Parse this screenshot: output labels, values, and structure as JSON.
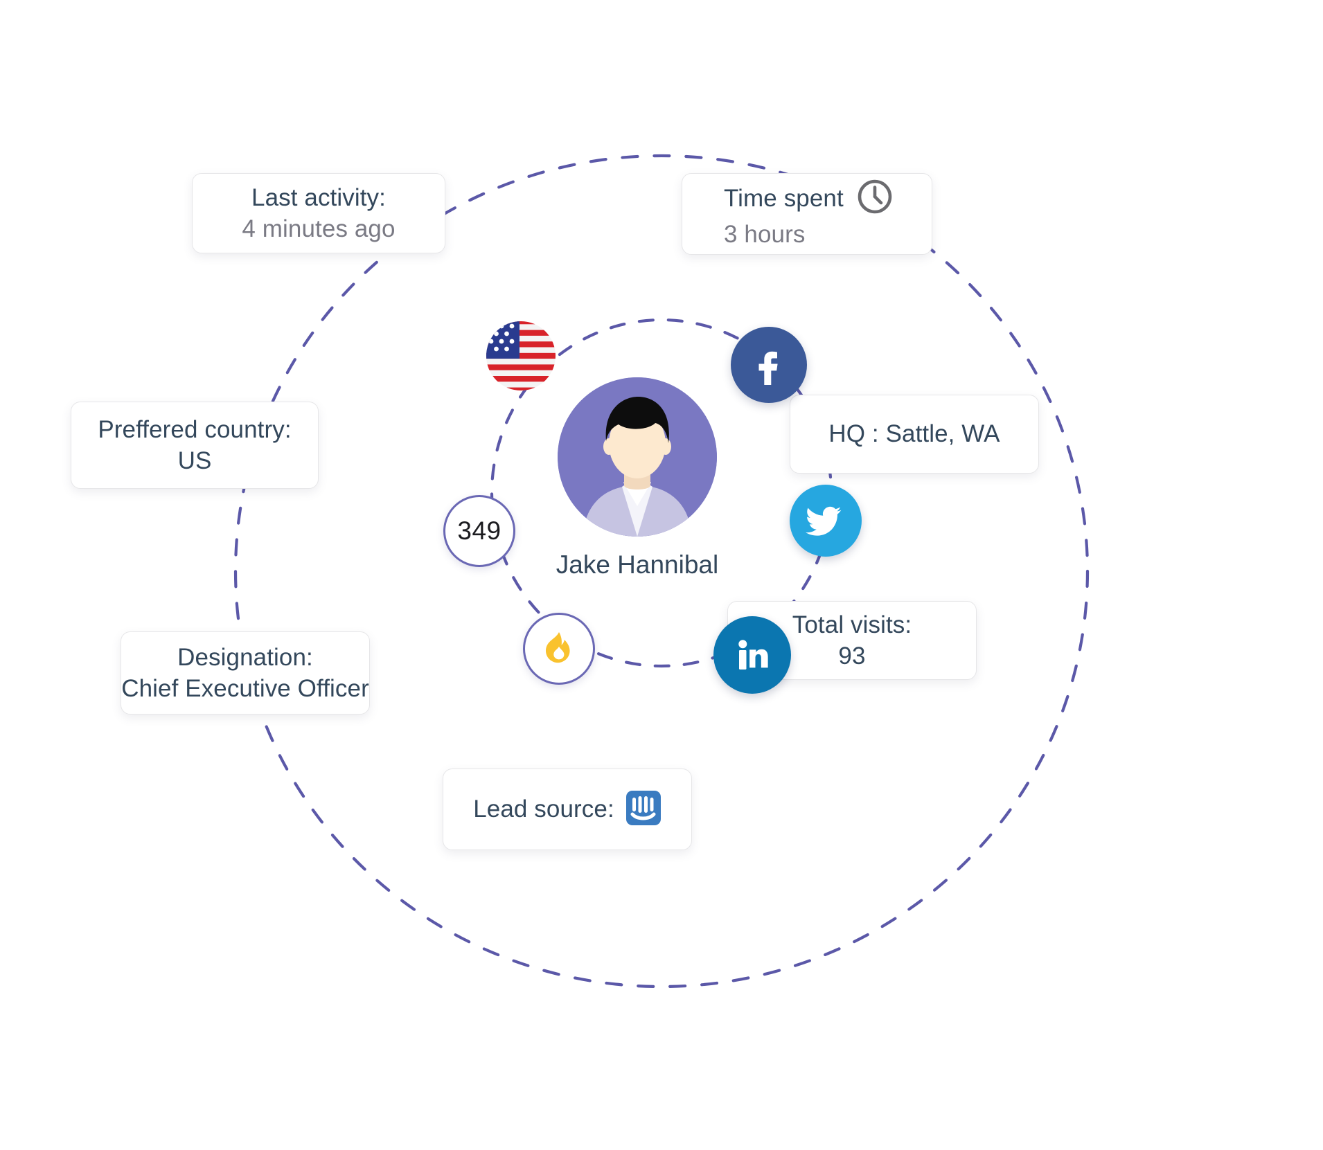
{
  "person": {
    "name": "Jake Hannibal",
    "avatar_icon": "male-avatar-illustration",
    "avatar_bg_color": "#7a78c2"
  },
  "center_nodes": [
    {
      "id": "flag",
      "icon": "us-flag-icon",
      "label": "US flag"
    },
    {
      "id": "facebook",
      "icon": "facebook-icon",
      "label": "Facebook",
      "color": "#3b5998"
    },
    {
      "id": "twitter",
      "icon": "twitter-icon",
      "label": "Twitter",
      "color": "#26a7e0"
    },
    {
      "id": "linkedin",
      "icon": "linkedin-icon",
      "label": "LinkedIn",
      "color": "#0b76b0"
    },
    {
      "id": "count",
      "icon": "score-badge",
      "value": "349",
      "color": "#6a68b4"
    },
    {
      "id": "flame",
      "icon": "flame-icon",
      "label": "Hot lead",
      "color": "#f9c22e"
    }
  ],
  "cards": {
    "last_activity": {
      "title": "Last activity:",
      "value": "4 minutes ago",
      "value_muted": true
    },
    "time_spent": {
      "title": "Time spent",
      "value": "3 hours",
      "value_muted": true,
      "icon": "clock-icon"
    },
    "preferred_country": {
      "title": "Preffered country:",
      "value": "US"
    },
    "hq": {
      "title": "HQ : Sattle, WA"
    },
    "designation": {
      "title": "Designation:",
      "value": "Chief Executive Officer"
    },
    "total_visits": {
      "title": "Total visits:",
      "value": "93"
    },
    "lead_source": {
      "title": "Lead source:",
      "icon": "intercom-icon",
      "icon_color": "#3a7bc0"
    }
  },
  "theme": {
    "dashed_line_color": "#5b58a8",
    "card_border_color": "#e6e6e8",
    "text_color": "#33475b",
    "muted_text_color": "#7a7a84",
    "background": "#ffffff"
  }
}
